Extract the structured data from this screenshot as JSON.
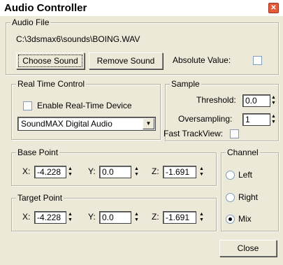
{
  "window": {
    "title": "Audio Controller"
  },
  "audio_file": {
    "legend": "Audio File",
    "path": "C:\\3dsmax6\\sounds\\BOING.WAV",
    "choose_label": "Choose Sound",
    "remove_label": "Remove Sound",
    "absolute_label": "Absolute Value:"
  },
  "realtime": {
    "legend": "Real Time Control",
    "enable_label": "Enable Real-Time Device",
    "device": "SoundMAX Digital Audio"
  },
  "sample": {
    "legend": "Sample",
    "threshold_label": "Threshold:",
    "threshold": "0.0",
    "oversampling_label": "Oversampling:",
    "oversampling": "1",
    "fast_label": "Fast TrackView:"
  },
  "base_point": {
    "legend": "Base Point",
    "x_label": "X:",
    "x": "-4.228",
    "y_label": "Y:",
    "y": "0.0",
    "z_label": "Z:",
    "z": "-1.691"
  },
  "target_point": {
    "legend": "Target Point",
    "x_label": "X:",
    "x": "-4.228",
    "y_label": "Y:",
    "y": "0.0",
    "z_label": "Z:",
    "z": "-1.691"
  },
  "channel": {
    "legend": "Channel",
    "left": "Left",
    "right": "Right",
    "mix": "Mix",
    "selected": "Mix"
  },
  "close_label": "Close"
}
